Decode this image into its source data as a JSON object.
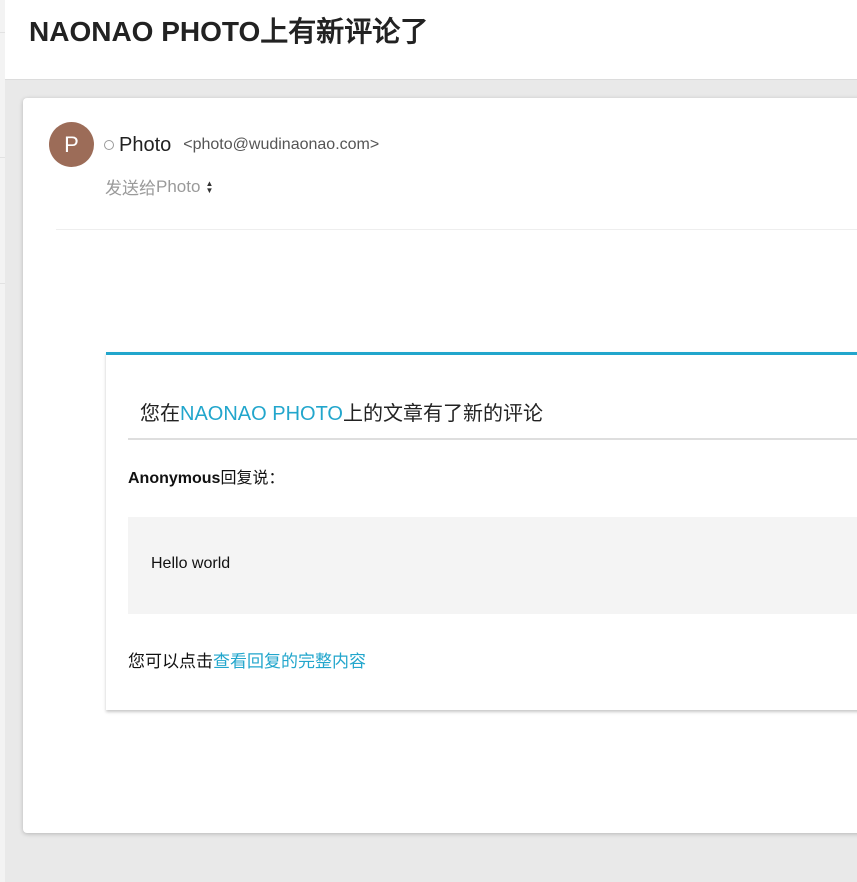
{
  "subject": "NAONAO PHOTO上有新评论了",
  "sender": {
    "avatar_letter": "P",
    "name": "Photo",
    "email": "<photo@wudinaonao.com>"
  },
  "recipient": {
    "prefix": "发送给",
    "name": "Photo"
  },
  "notification": {
    "title_prefix": "您在",
    "site_name": "NAONAO PHOTO",
    "title_suffix": "上的文章有了新的评论",
    "reply_author": "Anonymous",
    "reply_suffix": "回复说：",
    "comment": "Hello world",
    "footer_prefix": "您可以点击",
    "footer_link": "查看回复的完整内容"
  },
  "colors": {
    "accent": "#22a6cc",
    "avatar": "#9c6c58"
  }
}
